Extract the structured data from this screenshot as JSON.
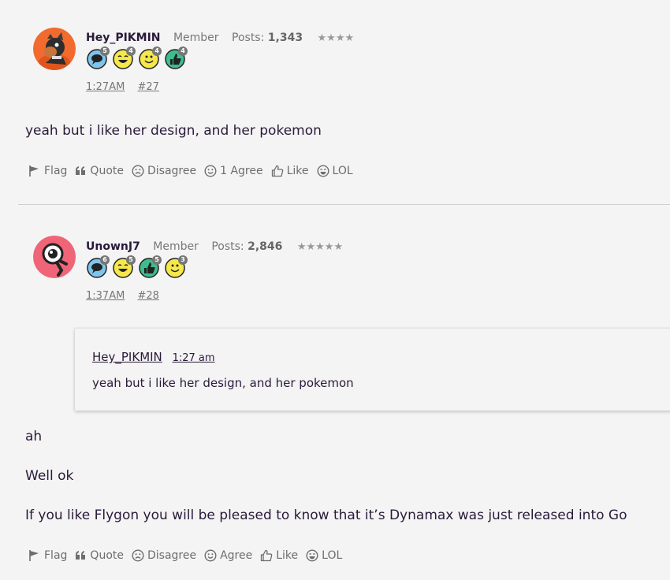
{
  "posts": [
    {
      "author": "Hey_PIKMIN",
      "role": "Member",
      "posts_label": "Posts:",
      "posts_count": "1,343",
      "stars": "★★★★",
      "badges": [
        {
          "icon": "speech-bubble-icon",
          "count": "5"
        },
        {
          "icon": "laughing-face-icon",
          "count": "4"
        },
        {
          "icon": "smiley-face-icon",
          "count": "4"
        },
        {
          "icon": "thumbs-up-icon",
          "count": "4"
        }
      ],
      "time": "1:27AM",
      "permalink": "#27",
      "body": [
        "yeah but i like her design, and her pokemon"
      ],
      "actions": {
        "flag": "Flag",
        "quote": "Quote",
        "disagree": "Disagree",
        "agree": "1 Agree",
        "like": "Like",
        "lol": "LOL"
      }
    },
    {
      "author": "UnownJ7",
      "role": "Member",
      "posts_label": "Posts:",
      "posts_count": "2,846",
      "stars": "★★★★★",
      "badges": [
        {
          "icon": "speech-bubble-icon",
          "count": "6"
        },
        {
          "icon": "laughing-face-icon",
          "count": "5"
        },
        {
          "icon": "thumbs-up-icon",
          "count": "5"
        },
        {
          "icon": "smiley-face-icon",
          "count": "3"
        }
      ],
      "time": "1:37AM",
      "permalink": "#28",
      "quote": {
        "author": "Hey_PIKMIN",
        "time": "1:27 am",
        "text": "yeah but i like her design, and her pokemon"
      },
      "body": [
        "ah",
        "Well ok",
        "If you like Flygon you will be pleased to know that it’s Dynamax was just released into Go"
      ],
      "actions": {
        "flag": "Flag",
        "quote": "Quote",
        "disagree": "Disagree",
        "agree": "Agree",
        "like": "Like",
        "lol": "LOL"
      }
    }
  ],
  "colors": {
    "background": "#f4f4f4",
    "text": "#2a1a3a",
    "muted": "#777777",
    "badge_blue": "#7ec4ec",
    "badge_yellow": "#f5e84b",
    "badge_green": "#3dbd8e"
  }
}
